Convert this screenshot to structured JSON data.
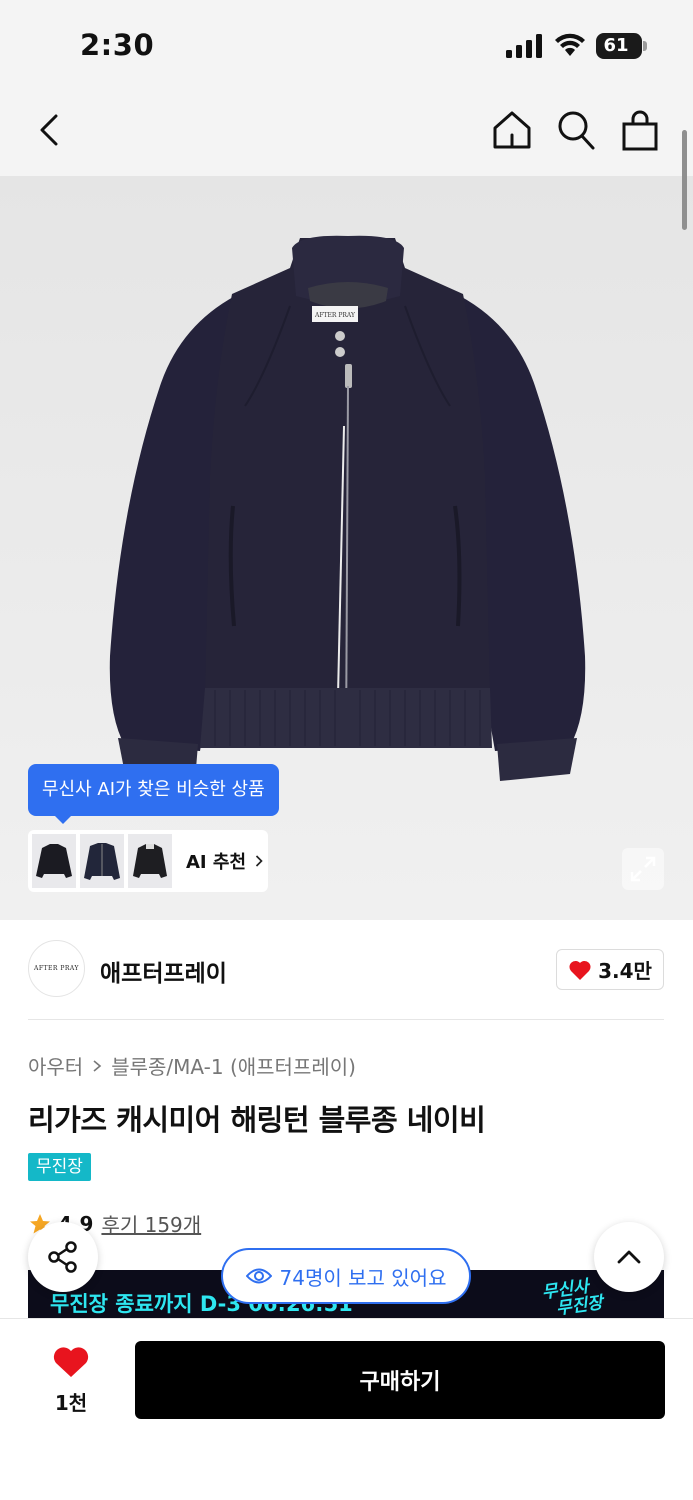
{
  "status_bar": {
    "time": "2:30",
    "battery": "61"
  },
  "nav": {
    "icons": [
      "back-icon",
      "home-icon",
      "search-icon",
      "cart-icon"
    ]
  },
  "hero": {
    "ai_tooltip": "무신사 AI가 찾은 비슷한 상품",
    "ai_label": "AI 추천",
    "jacket_label": "AFTER PRAY"
  },
  "brand": {
    "logo_text": "AFTER PRAY",
    "name": "애프터프레이",
    "likes": "3.4만"
  },
  "product": {
    "breadcrumb": [
      "아우터",
      "블루종/MA-1 (애프터프레이)"
    ],
    "title": "리가즈 캐시미어 해링턴 블루종 네이비",
    "badge": "무진장",
    "rating": "4.9",
    "reviews": "후기 159개"
  },
  "promo": {
    "text": "무진장 종료까지 D-3 06:26:51",
    "logo": "무신사\n무진장"
  },
  "viewers": "74명이 보고 있어요",
  "bottom": {
    "wish_count": "1천",
    "buy_label": "구매하기"
  },
  "colors": {
    "accent_blue": "#2f6ff0",
    "badge_teal": "#14b8c8",
    "promo_cyan": "#2ee6f0",
    "heart_red": "#e8141e"
  }
}
